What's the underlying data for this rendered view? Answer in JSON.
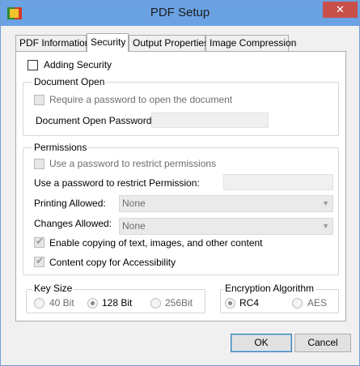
{
  "window": {
    "title": "PDF Setup",
    "close_glyph": "✕"
  },
  "tabs": [
    {
      "label": "PDF Information",
      "active": false
    },
    {
      "label": "Security",
      "active": true
    },
    {
      "label": "Output Properties",
      "active": false
    },
    {
      "label": "Image Compression",
      "active": false
    }
  ],
  "security": {
    "adding_security_label": "Adding Security",
    "adding_security_checked": false
  },
  "document_open": {
    "group_label": "Document Open",
    "require_password_label": "Require a password to open the document",
    "password_label": "Document Open Password:",
    "password_value": ""
  },
  "permissions": {
    "group_label": "Permissions",
    "use_password_label": "Use a password to restrict permissions",
    "restrict_password_label": "Use a password to restrict Permission:",
    "restrict_password_value": "",
    "printing_label": "Printing Allowed:",
    "printing_value": "None",
    "changes_label": "Changes Allowed:",
    "changes_value": "None",
    "enable_copying_label": "Enable copying of text, images, and other content",
    "enable_copying_checked": true,
    "accessibility_label": "Content copy for Accessibility",
    "accessibility_checked": true
  },
  "key_size": {
    "group_label": "Key Size",
    "options": [
      "40 Bit",
      "128 Bit",
      "256Bit"
    ],
    "selected": "128 Bit"
  },
  "encryption": {
    "group_label": "Encryption Algorithm",
    "options": [
      "RC4",
      "AES"
    ],
    "selected": "RC4"
  },
  "buttons": {
    "ok_label": "OK",
    "cancel_label": "Cancel"
  },
  "colors": {
    "titlebar": "#6aa2e4",
    "close_button": "#c7504a"
  }
}
